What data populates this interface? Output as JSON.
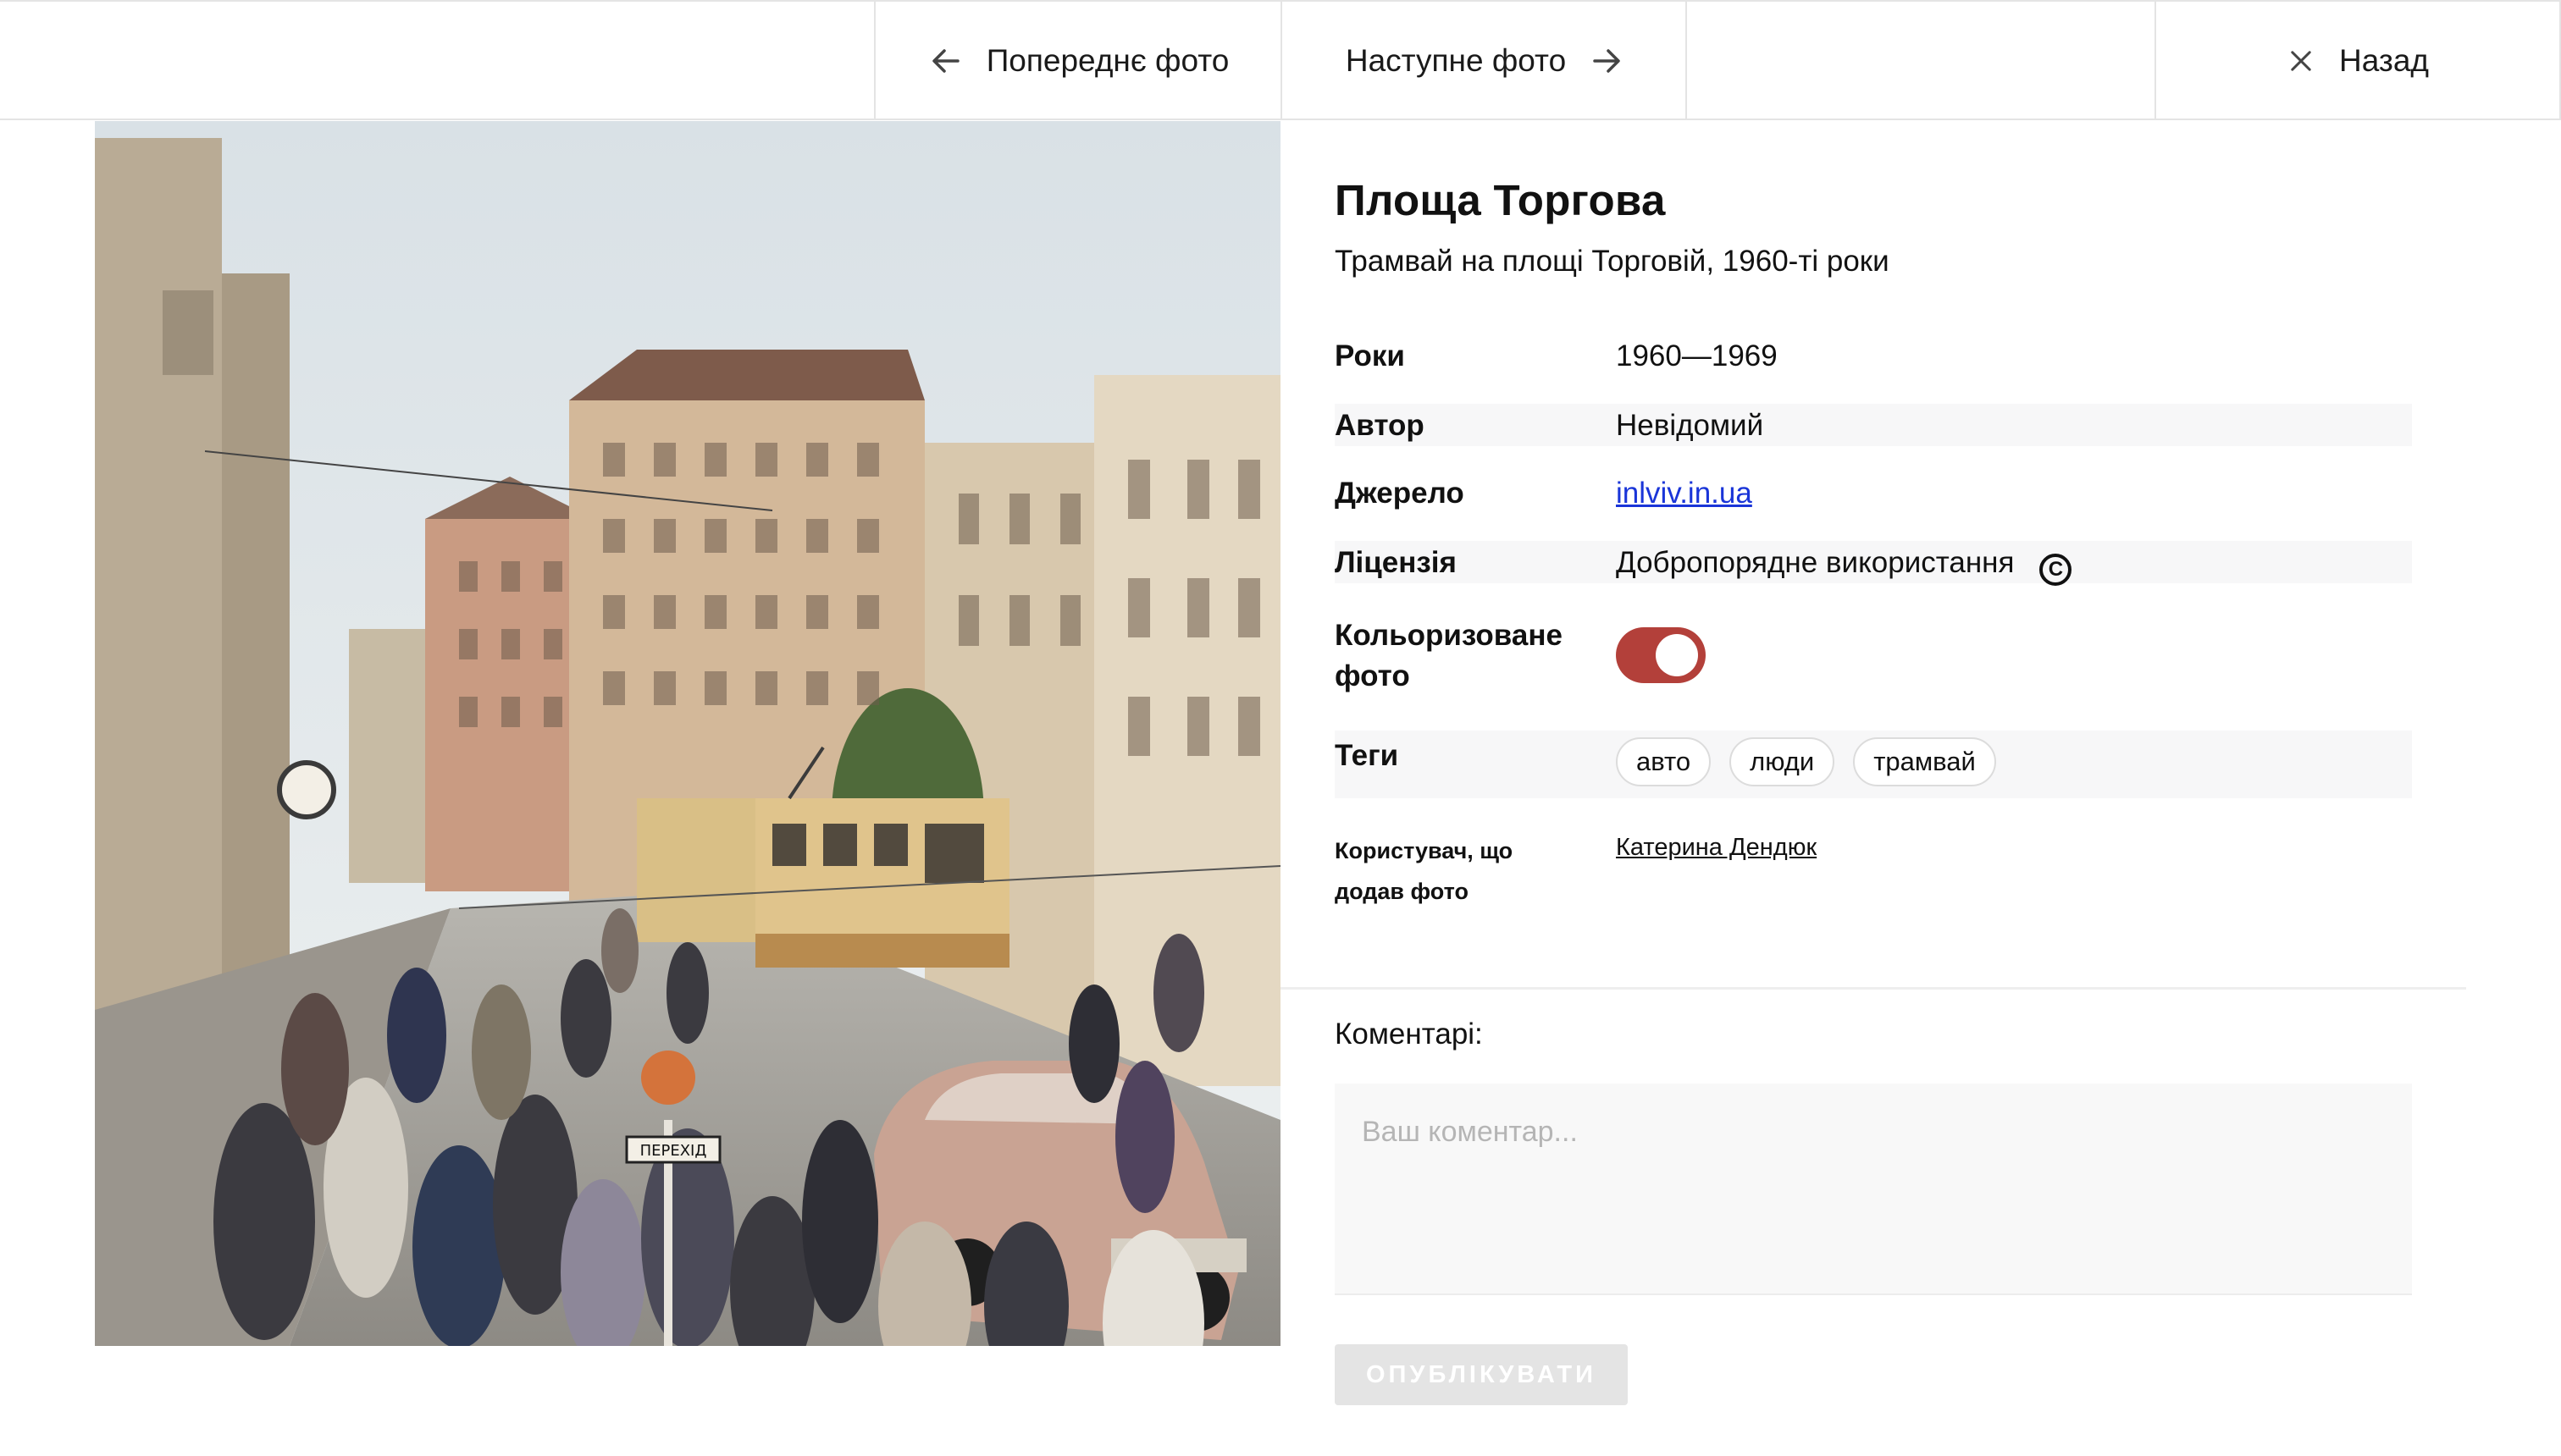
{
  "nav": {
    "prev_label": "Попереднє фото",
    "next_label": "Наступне фото",
    "back_label": "Назад"
  },
  "photo": {
    "description_icons": [
      "tram",
      "car",
      "crowd",
      "buildings"
    ],
    "sign_text_1": "ПЕРЕХІД",
    "sign_text_2": "ПЕРЕХІД"
  },
  "details": {
    "title": "Площа Торгова",
    "subtitle": "Трамвай на площі Торговій, 1960-ті роки",
    "years_label": "Роки",
    "years_value": "1960—1969",
    "author_label": "Автор",
    "author_value": "Невідомий",
    "source_label": "Джерело",
    "source_value": "inlviv.in.ua",
    "license_label": "Ліцензія",
    "license_value": "Добропорядне використання",
    "license_icon": "copyright-icon",
    "colorized_label_1": "Кольоризоване",
    "colorized_label_2": "фото",
    "colorized_on": true,
    "tags_label": "Теги",
    "tags": [
      "авто",
      "люди",
      "трамвай"
    ],
    "user_label_1": "Користувач, що",
    "user_label_2": "додав фото",
    "user_value": "Катерина Дендюк"
  },
  "comments": {
    "label": "Коментарі:",
    "placeholder": "Ваш коментар...",
    "publish_label": "ОПУБЛІКУВАТИ"
  },
  "colors": {
    "toggle_on": "#b3403a",
    "link": "#1a35d8",
    "button_disabled": "#e4e4e4"
  }
}
